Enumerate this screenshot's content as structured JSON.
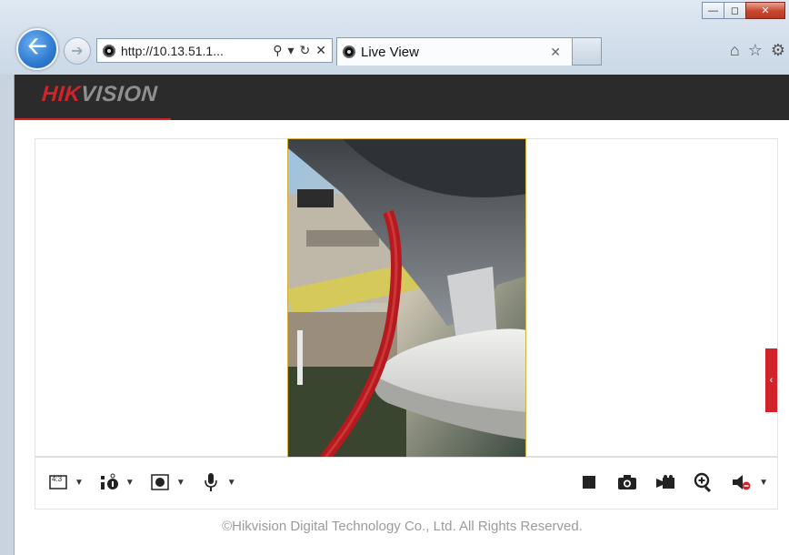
{
  "browser": {
    "address_url": "http://10.13.51.1...",
    "tab_title": "Live View",
    "window_controls": [
      "minimize",
      "maximize",
      "close"
    ]
  },
  "app": {
    "brand_red": "HIK",
    "brand_grey": "VISION",
    "colors": {
      "accent": "#d2232a",
      "header_bg": "#2b2b2b",
      "footer_text": "#9b9b9b"
    }
  },
  "toolbar": {
    "left_controls": [
      {
        "icon": "aspect-ratio-icon",
        "label": "4:3"
      },
      {
        "icon": "stream-type-icon"
      },
      {
        "icon": "plugin-icon"
      },
      {
        "icon": "microphone-icon"
      }
    ],
    "right_controls": [
      {
        "icon": "stop-icon"
      },
      {
        "icon": "camera-icon"
      },
      {
        "icon": "record-icon"
      },
      {
        "icon": "zoom-in-icon"
      },
      {
        "icon": "audio-muted-icon"
      }
    ]
  },
  "footer": {
    "copyright": "©Hikvision Digital Technology Co., Ltd. All Rights Reserved."
  }
}
